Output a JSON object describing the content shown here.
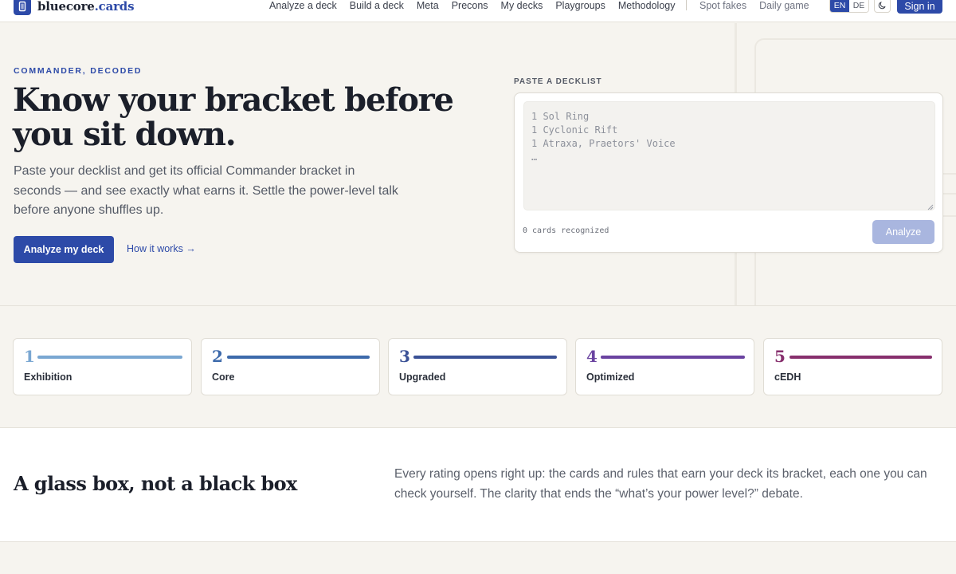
{
  "brand": {
    "name": "bluecore",
    "suffix": ".cards",
    "color": "#2d4aa8"
  },
  "nav": {
    "main": [
      "Analyze a deck",
      "Build a deck",
      "Meta",
      "Precons",
      "My decks",
      "Playgroups",
      "Methodology"
    ],
    "aux": [
      "Spot fakes",
      "Daily game"
    ]
  },
  "lang": {
    "active": "EN",
    "other": "DE"
  },
  "theme_toggle": {
    "icon": "moon-icon"
  },
  "signin_label": "Sign in",
  "hero": {
    "eyebrow": "COMMANDER, DECODED",
    "title": "Know your bracket before you sit down.",
    "subtitle": "Paste your decklist and get its official Commander bracket in seconds — and see exactly what earns it. Settle the power-level talk before anyone shuffles up.",
    "primary_cta": "Analyze my deck",
    "secondary_cta": "How it works →"
  },
  "decklist": {
    "label": "PASTE A DECKLIST",
    "placeholder": "1 Sol Ring\n1 Cyclonic Rift\n1 Atraxa, Praetors' Voice\n…",
    "status": "0 cards recognized",
    "analyze_label": "Analyze"
  },
  "brackets": [
    {
      "num": "1",
      "label": "Exhibition",
      "color": "#7aa7d2"
    },
    {
      "num": "2",
      "label": "Core",
      "color": "#3d6aab"
    },
    {
      "num": "3",
      "label": "Upgraded",
      "color": "#3a5196"
    },
    {
      "num": "4",
      "label": "Optimized",
      "color": "#6a43a0"
    },
    {
      "num": "5",
      "label": "cEDH",
      "color": "#872f6d"
    }
  ],
  "glass": {
    "title": "A glass box, not a black box",
    "text": "Every rating opens right up: the cards and rules that earn your deck its bracket, each one you can check yourself. The clarity that ends the “what’s your power level?” debate."
  }
}
